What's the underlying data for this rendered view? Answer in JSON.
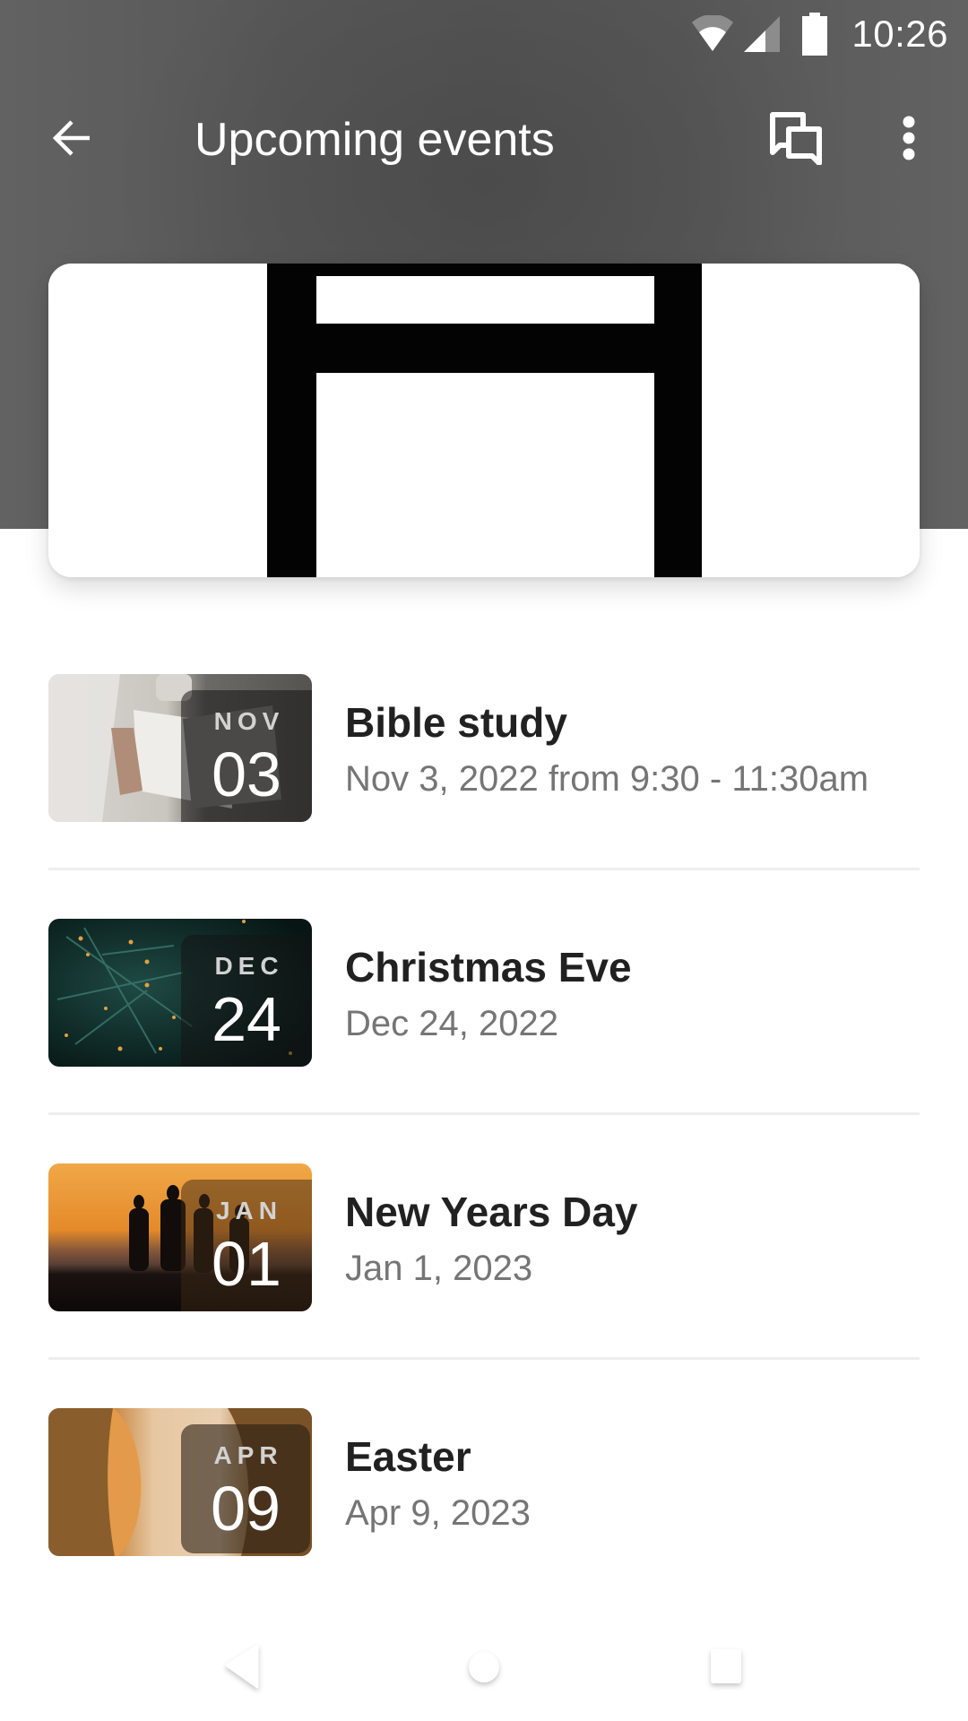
{
  "status_bar": {
    "time": "10:26",
    "icons": [
      "wifi-icon",
      "signal-icon",
      "battery-icon"
    ]
  },
  "app_bar": {
    "title": "Upcoming events",
    "back_icon": "arrow-left-icon",
    "chat_icon": "chat-bubbles-icon",
    "more_icon": "more-vertical-icon"
  },
  "colors": {
    "header_bg": "#5a5a5a",
    "title_text": "#212121",
    "subtitle_text": "#757575",
    "divider": "#eeeeee",
    "date_month": "#d2d2d2",
    "date_day": "#ffffff"
  },
  "events": [
    {
      "title": "Bible study",
      "date_text": "Nov 3, 2022 from 9:30 - 11:30am",
      "badge_month": "NOV",
      "badge_day": "03",
      "image_subject": "open bible on blanket"
    },
    {
      "title": "Christmas Eve",
      "date_text": "Dec 24, 2022",
      "badge_month": "DEC",
      "badge_day": "24",
      "image_subject": "evergreen branches with lights"
    },
    {
      "title": "New Years Day",
      "date_text": "Jan 1, 2023",
      "badge_month": "JAN",
      "badge_day": "01",
      "image_subject": "family silhouette at sunset"
    },
    {
      "title": "Easter",
      "date_text": "Apr 9, 2023",
      "badge_month": "APR",
      "badge_day": "09",
      "image_subject": "empty tomb stone"
    }
  ],
  "nav_bar": {
    "buttons": [
      "nav-back-icon",
      "nav-home-icon",
      "nav-recents-icon"
    ]
  }
}
